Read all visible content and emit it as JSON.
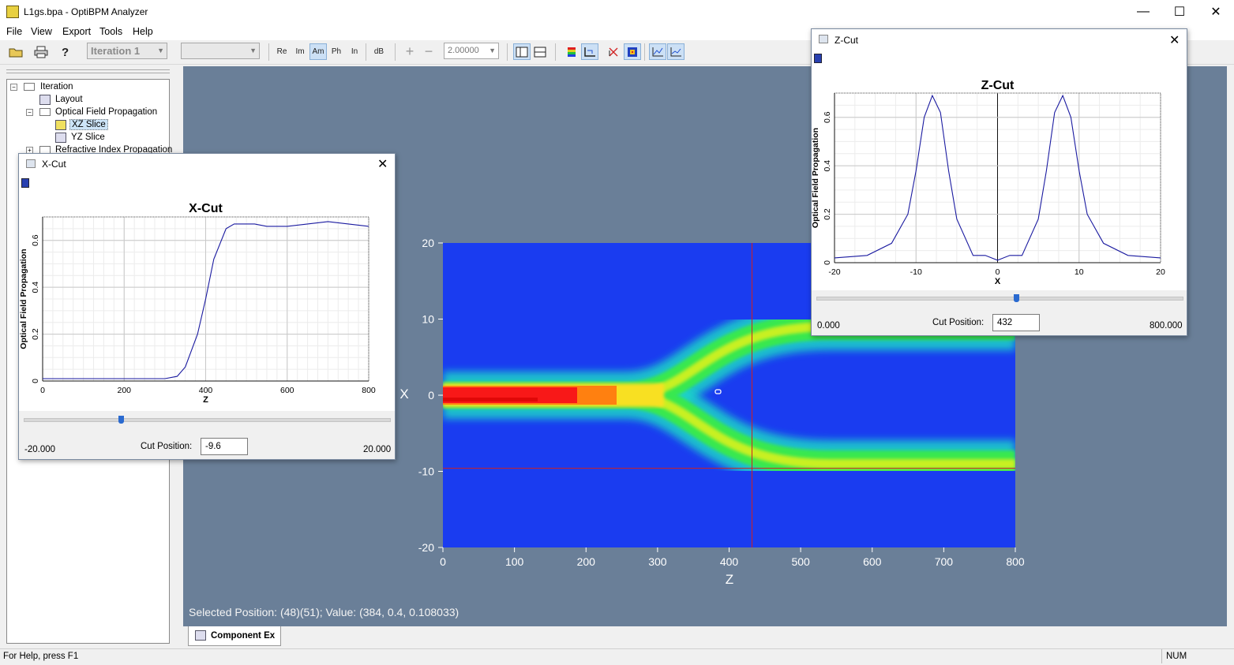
{
  "window": {
    "title": "L1gs.bpa - OptiBPM Analyzer",
    "min_symbol": "—",
    "max_symbol": "☐",
    "close_symbol": "✕"
  },
  "menu": [
    "File",
    "View",
    "Export",
    "Tools",
    "Help"
  ],
  "toolbar": {
    "iteration_select": "Iteration 1",
    "empty_select": "",
    "buttons": [
      "Re",
      "Im",
      "Am",
      "Ph",
      "In",
      "dB"
    ],
    "active_button": "Am",
    "plus": "+",
    "minus": "−",
    "zoom_value": "2.00000"
  },
  "tree": {
    "root": "Iteration",
    "layout": "Layout",
    "ofp": "Optical Field Propagation",
    "xz": "XZ Slice",
    "yz": "YZ Slice",
    "rip": "Refractive Index Propagation"
  },
  "heatmap": {
    "xlabel": "Z",
    "ylabel": "X",
    "xticks": [
      "0",
      "100",
      "200",
      "300",
      "400",
      "500",
      "600",
      "700",
      "800"
    ],
    "yticks": [
      "20",
      "10",
      "0",
      "-10",
      "-20"
    ],
    "cursor_z": 432,
    "cursor_x": -9.6,
    "colors": {
      "bg": "#1a3cf0",
      "mid": "#1ee060",
      "high": "#ff1010"
    }
  },
  "selected_position": "Selected Position: (48)(51); Value: (384, 0.4, 0.108033)",
  "tab_label": "Component Ex",
  "status": {
    "help": "For Help, press F1",
    "num": "NUM"
  },
  "xcut": {
    "title": "X-Cut",
    "plot_title": "X-Cut",
    "ylabel": "Optical Field Propagation",
    "xlabel": "Z",
    "xticks": [
      "0",
      "200",
      "400",
      "600",
      "800"
    ],
    "yticks": [
      "0",
      "0.2",
      "0.4",
      "0.6"
    ],
    "cut_label": "Cut Position:",
    "cut_value": "-9.6",
    "min": "-20.000",
    "max": "20.000",
    "slider_fraction": 0.26
  },
  "zcut": {
    "title": "Z-Cut",
    "plot_title": "Z-Cut",
    "ylabel": "Optical Field Propagation",
    "xlabel": "X",
    "xticks": [
      "-20",
      "-10",
      "0",
      "10",
      "20"
    ],
    "yticks": [
      "0",
      "0.2",
      "0.4",
      "0.6"
    ],
    "cut_label": "Cut Position:",
    "cut_value": "432",
    "min": "0.000",
    "max": "800.000",
    "slider_fraction": 0.54
  },
  "chart_data": [
    {
      "type": "line",
      "title": "X-Cut",
      "xlabel": "Z",
      "ylabel": "Optical Field Propagation",
      "xlim": [
        0,
        800
      ],
      "ylim": [
        0,
        0.7
      ],
      "x": [
        0,
        100,
        200,
        250,
        300,
        330,
        350,
        380,
        400,
        420,
        450,
        470,
        490,
        520,
        550,
        600,
        650,
        700,
        750,
        800
      ],
      "y": [
        0.01,
        0.01,
        0.01,
        0.01,
        0.01,
        0.02,
        0.06,
        0.2,
        0.35,
        0.52,
        0.65,
        0.67,
        0.67,
        0.67,
        0.66,
        0.66,
        0.67,
        0.68,
        0.67,
        0.66
      ]
    },
    {
      "type": "line",
      "title": "Z-Cut",
      "xlabel": "X",
      "ylabel": "Optical Field Propagation",
      "xlim": [
        -20,
        20
      ],
      "ylim": [
        0,
        0.7
      ],
      "x": [
        -20,
        -16,
        -13,
        -11,
        -10,
        -9,
        -8,
        -7,
        -6,
        -5,
        -3,
        -1.5,
        0,
        1.5,
        3,
        5,
        6,
        7,
        8,
        9,
        10,
        11,
        13,
        16,
        20
      ],
      "y": [
        0.02,
        0.03,
        0.08,
        0.2,
        0.38,
        0.6,
        0.69,
        0.62,
        0.38,
        0.18,
        0.03,
        0.03,
        0.01,
        0.03,
        0.03,
        0.18,
        0.38,
        0.62,
        0.69,
        0.6,
        0.38,
        0.2,
        0.08,
        0.03,
        0.02
      ]
    }
  ]
}
